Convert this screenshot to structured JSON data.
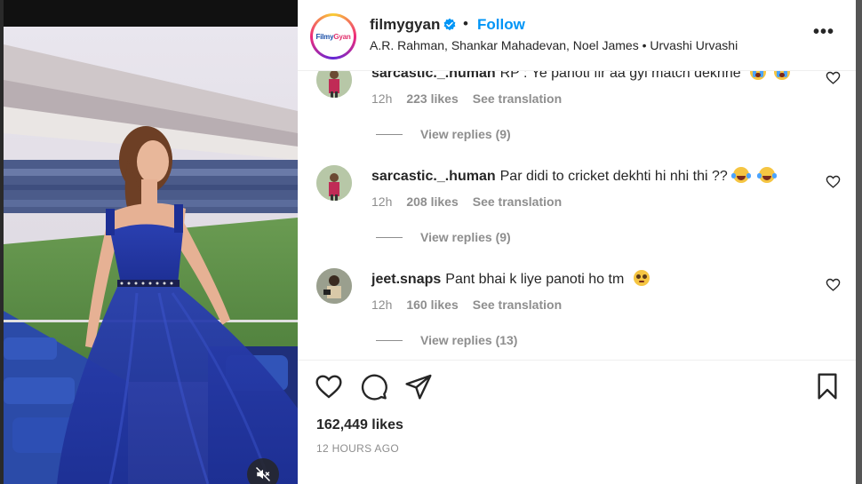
{
  "post": {
    "username": "filmygyan",
    "avatar_text_a": "Filmy",
    "avatar_text_b": "Gyan",
    "separator": "•",
    "follow_label": "Follow",
    "audio": "A.R. Rahman, Shankar Mahadevan, Noel James • Urvashi Urvashi",
    "more_label": "•••"
  },
  "comments": [
    {
      "user": "sarcastic._.human",
      "text": "RP : Ye panoti fir aa gyi match dekhne",
      "emojis": [
        "loudly-crying-face",
        "loudly-crying-face"
      ],
      "time": "12h",
      "likes": "223 likes",
      "translate": "See translation",
      "replies": "View replies (9)"
    },
    {
      "user": "sarcastic._.human",
      "text": "Par didi to cricket dekhti hi nhi thi ??",
      "emojis": [
        "tears-of-joy-face",
        "tears-of-joy-face"
      ],
      "time": "12h",
      "likes": "208 likes",
      "translate": "See translation",
      "replies": "View replies (9)"
    },
    {
      "user": "jeet.snaps",
      "text": "Pant bhai k liye panoti ho tm",
      "emojis": [
        "pleading-face"
      ],
      "time": "12h",
      "likes": "160 likes",
      "translate": "See translation",
      "replies": "View replies (13)"
    }
  ],
  "footer": {
    "likes": "162,449 likes",
    "ago": "12 HOURS AGO"
  },
  "colors": {
    "accent": "#0095f6",
    "text": "#262626",
    "muted": "#8e8e8e",
    "dress": "#2a3fb0"
  }
}
